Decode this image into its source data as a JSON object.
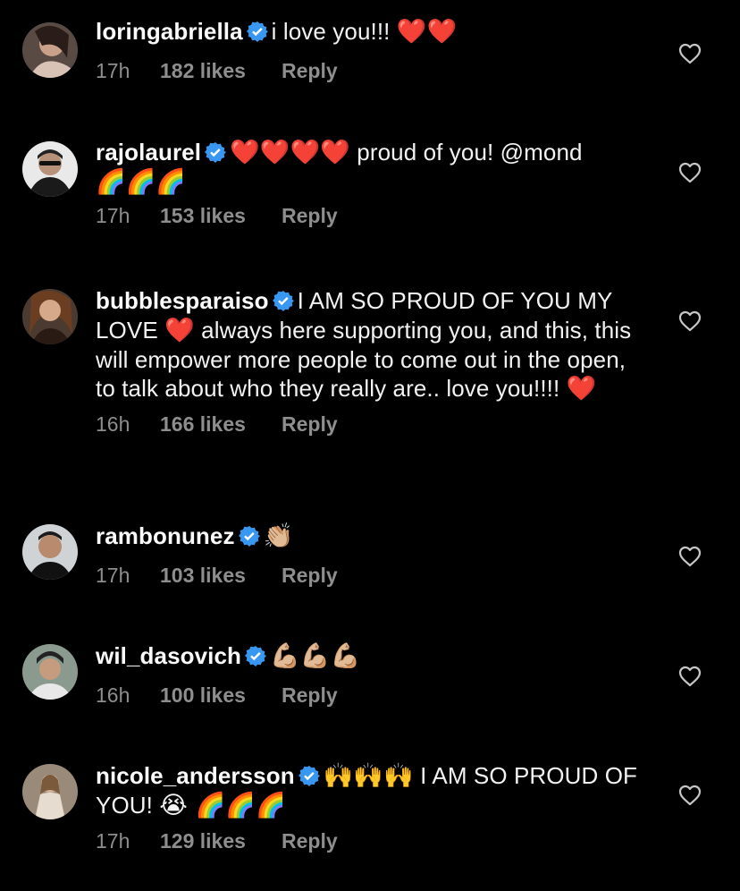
{
  "comments": [
    {
      "username": "loringabriella",
      "verified": true,
      "text_before": "i love you!!! ",
      "emojis": "❤️❤️",
      "text_after": "",
      "time": "17h",
      "likes": "182 likes",
      "reply": "Reply"
    },
    {
      "username": "rajolaurel",
      "verified": true,
      "text_before": "",
      "emojis": "❤️❤️❤️❤️",
      "text_after": " proud of you! @mond",
      "extra_emojis": "🌈🌈🌈",
      "time": "17h",
      "likes": "153 likes",
      "reply": "Reply"
    },
    {
      "username": "bubblesparaiso",
      "verified": true,
      "text_before": "I AM SO PROUD OF YOU MY LOVE ",
      "emojis": "❤️",
      "text_after": " always here supporting you, and this, this will empower more people to come out in the open, to talk about who they really are.. love you!!!! ",
      "extra_emojis": "❤️",
      "time": "16h",
      "likes": "166 likes",
      "reply": "Reply"
    },
    {
      "username": "rambonunez",
      "verified": true,
      "text_before": "",
      "emojis": "👏🏼",
      "text_after": "",
      "time": "17h",
      "likes": "103 likes",
      "reply": "Reply"
    },
    {
      "username": "wil_dasovich",
      "verified": true,
      "text_before": "",
      "emojis": "💪🏼💪🏼💪🏼",
      "text_after": "",
      "time": "16h",
      "likes": "100 likes",
      "reply": "Reply"
    },
    {
      "username": "nicole_andersson",
      "verified": true,
      "text_before": "",
      "emojis": "🙌🙌🙌",
      "text_after": " I AM SO PROUD OF YOU! ",
      "extra_emojis": "😭 🌈🌈🌈",
      "time": "17h",
      "likes": "129 likes",
      "reply": "Reply"
    }
  ],
  "colors": {
    "background": "#000000",
    "text": "#f2f2f2",
    "meta": "#8e8e8e",
    "verified": "#3897f0",
    "heart": "#ff2e43"
  },
  "icons": {
    "verified": "verified-badge-icon",
    "like": "heart-outline-icon"
  }
}
